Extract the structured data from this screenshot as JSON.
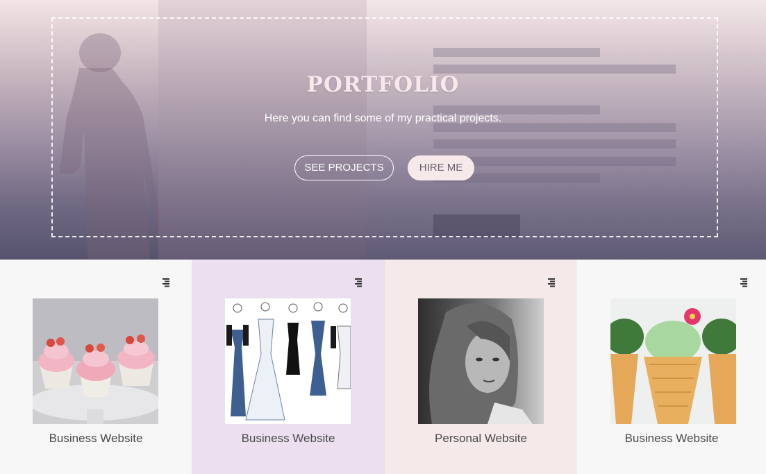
{
  "hero": {
    "title": "PORTFOLIO",
    "subtitle": "Here you can find some of my practical projects.",
    "see_projects_label": "SEE PROJECTS",
    "hire_me_label": "HIRE ME"
  },
  "cards": [
    {
      "caption": "Business Website",
      "background": "#f8f7f7",
      "image": "cupcakes"
    },
    {
      "caption": "Business Website",
      "background": "#ebdff0",
      "image": "fashion-sketches"
    },
    {
      "caption": "Personal Website",
      "background": "#f6e9ea",
      "image": "woman-portrait"
    },
    {
      "caption": "Business Website",
      "background": "#f8f7f7",
      "image": "ice-cream-cactus"
    }
  ],
  "icons": {
    "card_menu": "menu-lines-icon"
  },
  "colors": {
    "accent": "#f7e9ea",
    "hero_dark": "#56526d"
  }
}
